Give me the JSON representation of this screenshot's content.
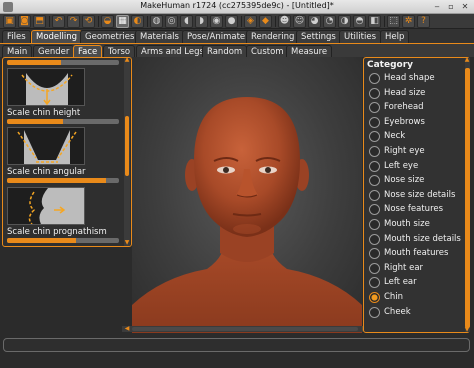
{
  "window": {
    "title": "MakeHuman r1724 (cc275395de9c) - [Untitled]*"
  },
  "toolbar": {
    "icons": [
      "undo-icon",
      "redo-icon",
      "reset-icon",
      "save-icon",
      "load-icon",
      "export-icon",
      "wireframe-icon",
      "grid-icon",
      "smooth-icon",
      "skin-icon",
      "front-view-icon",
      "back-view-icon",
      "left-view-icon",
      "right-view-icon",
      "top-view-icon",
      "bottom-view-icon",
      "global-camera-icon",
      "camera-icon",
      "settings-icon",
      "help-icon"
    ]
  },
  "main_tabs": [
    "Files",
    "Modelling",
    "Geometries",
    "Materials",
    "Pose/Animate",
    "Rendering",
    "Settings",
    "Utilities",
    "Help"
  ],
  "main_tabs_active": "Modelling",
  "sub_tabs": [
    "Main",
    "Gender",
    "Face",
    "Torso",
    "Arms and Legs",
    "Random",
    "Custom",
    "Measure"
  ],
  "sub_tabs_active": "Face",
  "left_panel": {
    "sliders": [
      {
        "label": "",
        "value": 0.48
      },
      {
        "label": "Scale chin height",
        "value": 0.5
      },
      {
        "label": "Scale chin angular",
        "value": 0.88
      },
      {
        "label": "Scale chin prognathism",
        "value": 0.62
      }
    ]
  },
  "right_panel": {
    "title": "Category",
    "items": [
      "Head shape",
      "Head size",
      "Forehead",
      "Eyebrows",
      "Neck",
      "Right eye",
      "Left eye",
      "Nose size",
      "Nose size details",
      "Nose features",
      "Mouth size",
      "Mouth size details",
      "Mouth features",
      "Right ear",
      "Left ear",
      "Chin",
      "Cheek"
    ],
    "selected": "Chin"
  },
  "status": {
    "text": ""
  },
  "colors": {
    "accent": "#e98a1a",
    "skin": "#b04a2a",
    "background": "#2b2b2b"
  }
}
